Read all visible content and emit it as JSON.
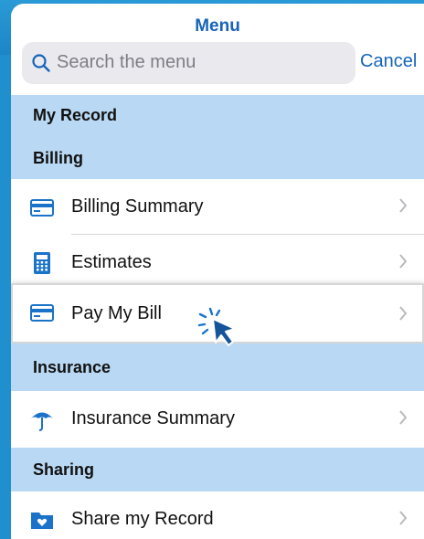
{
  "header": {
    "title": "Menu"
  },
  "search": {
    "placeholder": "Search the menu",
    "cancel_label": "Cancel"
  },
  "sections": {
    "my_record": "My Record",
    "billing": "Billing",
    "insurance": "Insurance",
    "sharing": "Sharing"
  },
  "items": {
    "billing_summary": "Billing Summary",
    "estimates": "Estimates",
    "pay_my_bill": "Pay My Bill",
    "insurance_summary": "Insurance Summary",
    "share_my_record": "Share my Record"
  },
  "icons": {
    "billing_summary": "credit-card-icon",
    "estimates": "calculator-icon",
    "pay_my_bill": "credit-card-icon",
    "insurance_summary": "umbrella-icon",
    "share_my_record": "folder-heart-icon"
  },
  "colors": {
    "accent": "#1664b8",
    "section_bg": "#b9d8f3",
    "backdrop": "#1f8fcd"
  }
}
